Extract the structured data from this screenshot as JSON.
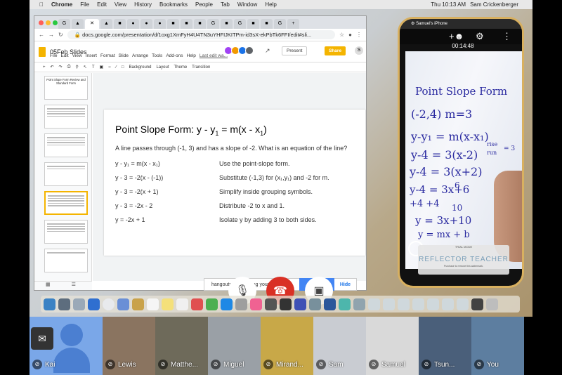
{
  "menubar": {
    "app": "Chrome",
    "items": [
      "File",
      "Edit",
      "View",
      "History",
      "Bookmarks",
      "People",
      "Tab",
      "Window",
      "Help"
    ],
    "clock": "Thu 10:13 AM",
    "user": "Sam Crickenberger"
  },
  "browser": {
    "url": "docs.google.com/presentation/d/1oxg1XmFyH4U4TN3uYHFIJKITPm-id3sX-ekPbTk6FFI/edit#sli..."
  },
  "slides_app": {
    "doc_title": "05Feb Slides",
    "menus": [
      "File",
      "Edit",
      "View",
      "Insert",
      "Format",
      "Slide",
      "Arrange",
      "Tools",
      "Add-ons",
      "Help"
    ],
    "last_edit": "Last edit wa...",
    "present_label": "Present",
    "share_label": "Share",
    "user_initial": "S",
    "toolbar": [
      "Background",
      "Layout",
      "Theme",
      "Transition"
    ]
  },
  "filmstrip": [
    {
      "num": "1",
      "title": "Point Slope Form Review and Standard Form"
    },
    {
      "num": "2",
      "title": ""
    },
    {
      "num": "3",
      "title": ""
    },
    {
      "num": "4",
      "title": ""
    },
    {
      "num": "5",
      "title": ""
    },
    {
      "num": "6",
      "title": ""
    },
    {
      "num": "7",
      "title": ""
    }
  ],
  "slide": {
    "heading": "Point Slope Form: y - y",
    "heading_sub": "1",
    "heading_rest": " = m(x - x",
    "heading_sub2": "1",
    "heading_end": ")",
    "question": "A line passes through (-1, 3) and has a slope of -2.  What is an equation of the line?",
    "rows": [
      {
        "eq": "y - y₁ = m(x - x₁)",
        "note": "Use the point-slope form."
      },
      {
        "eq": "y - 3 = -2(x - (-1))",
        "note": "Substitute (-1,3) for (x₁,y₁) and -2 for m."
      },
      {
        "eq": "y - 3 = -2(x + 1)",
        "note": "Simplify inside grouping symbols."
      },
      {
        "eq": "y - 3 = -2x - 2",
        "note": "Distribute -2 to x and 1."
      },
      {
        "eq": "y = -2x + 1",
        "note": "Isolate y by adding 3 to both sides."
      }
    ]
  },
  "notification": {
    "text": "hangouts... is sharing your screen.",
    "hide": "Hide"
  },
  "phone": {
    "device": "Samuel's iPhone",
    "timer": "00:14:48",
    "watermark_small": "TRIAL MODE",
    "watermark_big": "REFLECTOR TEACHER",
    "watermark_tiny": "Purchase to remove this watermark.",
    "board_lines": [
      "Point Slope Form",
      "(-2,4)   m=3",
      "y-y₁ = m(x-x₁)",
      "y-4 = 3(x-2)",
      "y-4 = 3(x+2)",
      "y-4 = 3x+6",
      "+4         +4",
      "y = 3x+10",
      "y = mx + b"
    ],
    "board_notes": [
      "rise",
      "run",
      "= 3",
      "10",
      "6"
    ]
  },
  "participants": [
    {
      "name": "Kai",
      "color": "#7aa7e8"
    },
    {
      "name": "Lewis",
      "color": "#8a7460"
    },
    {
      "name": "Matthe...",
      "color": "#6e6a5a"
    },
    {
      "name": "Miguel",
      "color": "#9aa0a6"
    },
    {
      "name": "Mirand...",
      "color": "#c8a848"
    },
    {
      "name": "Sam",
      "color": "#c9ccd2"
    },
    {
      "name": "Samuel",
      "color": "#d9d9d9"
    },
    {
      "name": "Tsun...",
      "color": "#4a5f7a"
    },
    {
      "name": "You",
      "color": "#5d7ea0"
    }
  ]
}
